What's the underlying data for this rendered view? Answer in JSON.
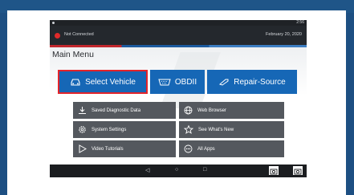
{
  "status_bar": {
    "time": "2:56"
  },
  "app_bar": {
    "connection_status": "Not Connected",
    "date": "February 20, 2020"
  },
  "main_menu": {
    "title": "Main Menu",
    "primary_buttons": [
      {
        "label": "Select Vehicle",
        "icon": "car-icon"
      },
      {
        "label": "OBDII",
        "icon": "obd-connector-icon"
      },
      {
        "label": "Repair-Source",
        "icon": "wrench-icon"
      }
    ],
    "secondary_buttons": [
      {
        "label": "Saved Diagnostic Data",
        "icon": "download-icon"
      },
      {
        "label": "Web Browser",
        "icon": "globe-icon"
      },
      {
        "label": "System Settings",
        "icon": "gear-icon"
      },
      {
        "label": "See What's New",
        "icon": "star-icon"
      },
      {
        "label": "Video Tutorials",
        "icon": "play-icon"
      },
      {
        "label": "All Apps",
        "icon": "apps-icon"
      }
    ]
  },
  "nav_bar": {
    "back_glyph": "◁",
    "home_glyph": "○",
    "recents_glyph": "□",
    "icons": [
      "screenshot-camera-icon",
      "camera-icon"
    ]
  },
  "colors": {
    "page_background": "#1d4f82",
    "primary_button": "#1667b6",
    "secondary_button": "#54585e",
    "highlight_border": "#e3232a",
    "disconnected": "#e02a2a"
  }
}
